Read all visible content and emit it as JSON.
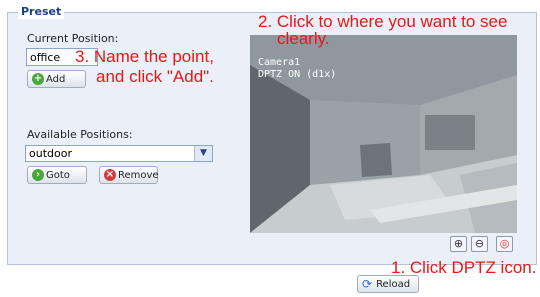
{
  "panel": {
    "legend": "Preset"
  },
  "current": {
    "label": "Current Position:",
    "value": "office",
    "add_label": "Add"
  },
  "available": {
    "label": "Available Positions:",
    "selected": "outdoor",
    "goto_label": "Goto",
    "remove_label": "Remove"
  },
  "camera": {
    "line1": "Camera1",
    "line2": "DPTZ  ON (d1x)"
  },
  "controls": {
    "zoom_in_icon": "zoom-in-icon",
    "zoom_out_icon": "zoom-out-icon",
    "dptz_icon": "dptz-icon"
  },
  "annotations": {
    "a1": "1. Click DPTZ icon.",
    "a2_line1": "2. Click to where you want to see",
    "a2_line2": "clearly.",
    "a3_line1": "3. Name the point,",
    "a3_line2": "and click \"Add\"."
  },
  "footer": {
    "reload_label": "Reload"
  },
  "colors": {
    "annotation": "#e81818",
    "legend": "#1d3f86",
    "panel": "#eaeff8"
  }
}
